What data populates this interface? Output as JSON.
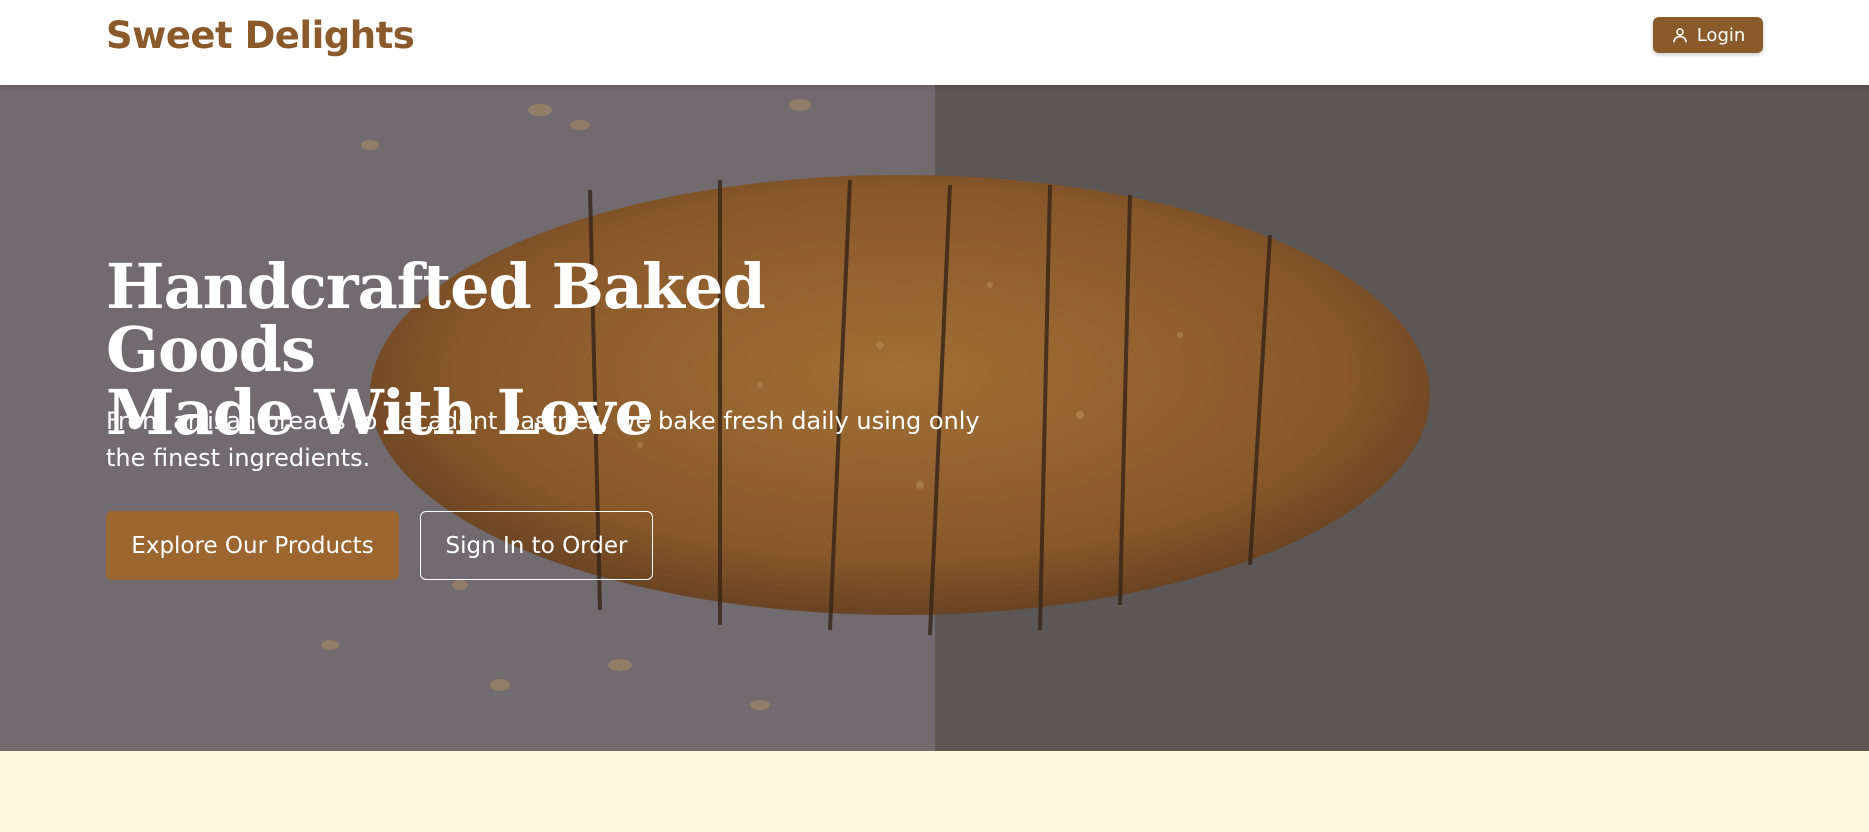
{
  "header": {
    "brand": "Sweet Delights",
    "login_label": "Login",
    "login_icon": "user-icon"
  },
  "hero": {
    "title_line1": "Handcrafted Baked Goods",
    "title_line2": "Made With Love",
    "subtitle": "From artisan breads to decadent pastries, we bake fresh daily using only the finest ingredients.",
    "primary_cta": "Explore Our Products",
    "secondary_cta": "Sign In to Order",
    "background_image": "sliced-seeded-bread-loaf"
  },
  "colors": {
    "brand": "#8b5a2b",
    "primary_button": "#9c6630",
    "page_background": "#fff8e1"
  }
}
